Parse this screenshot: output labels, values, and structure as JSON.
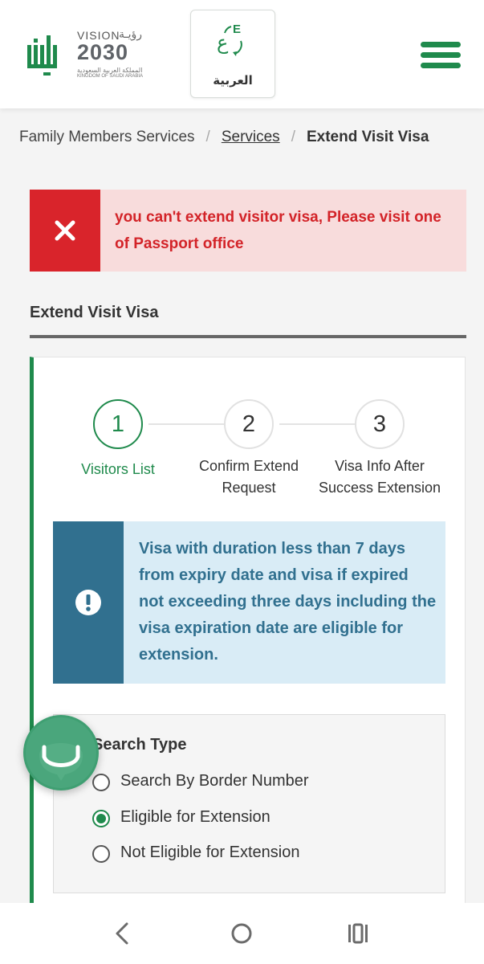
{
  "header": {
    "logo_vision_label": "VISION",
    "logo_vision_arabic": "رؤيـة",
    "logo_vision_year": "2030",
    "logo_kingdom_arabic": "المملكة العربية السعودية",
    "logo_kingdom_english": "KINGDOM OF SAUDI ARABIA",
    "language_button_label": "العربية",
    "menu_icon": "hamburger-icon"
  },
  "breadcrumb": {
    "items": [
      "Family Members Services",
      "Services",
      "Extend Visit Visa"
    ],
    "separator": "/"
  },
  "error_alert": {
    "message": "you can't extend visitor visa, Please visit one of Passport office",
    "icon": "close-icon",
    "color": "#d9242b"
  },
  "section": {
    "title": "Extend Visit Visa"
  },
  "stepper": {
    "steps": [
      {
        "number": "1",
        "label": "Visitors List",
        "active": true
      },
      {
        "number": "2",
        "label_line1": "Confirm Extend",
        "label_line2": "Request",
        "active": false
      },
      {
        "number": "3",
        "label_line1": "Visa Info After",
        "label_line2": "Success Extension",
        "active": false
      }
    ]
  },
  "info_alert": {
    "message": "Visa with duration less than 7 days from expiry date and visa if expired not exceeding three days including the visa expiration date are eligible for extension.",
    "icon": "exclamation-icon",
    "color": "#31708f"
  },
  "search_panel": {
    "title": "Search Type",
    "options": [
      {
        "label": "Search By Border Number",
        "checked": false
      },
      {
        "label": "Eligible for Extension",
        "checked": true
      },
      {
        "label": "Not Eligible for Extension",
        "checked": false
      }
    ]
  },
  "colors": {
    "brand_green": "#1f8a4c",
    "error_red": "#d9242b",
    "info_blue": "#31708f"
  },
  "bottom_nav": {
    "icons": [
      "back-icon",
      "home-icon",
      "recent-apps-icon"
    ]
  }
}
